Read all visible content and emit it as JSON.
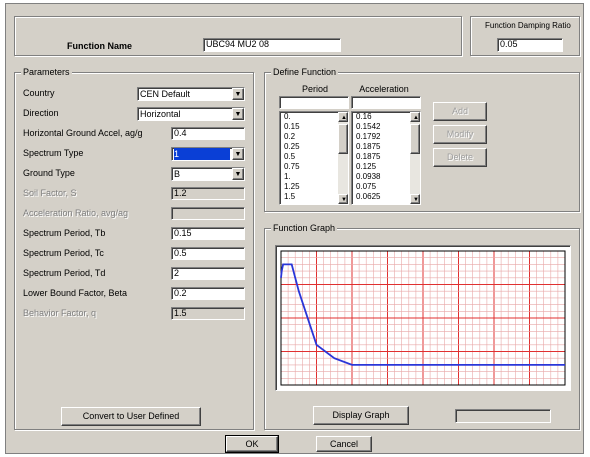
{
  "header": {
    "function_name_label": "Function Name",
    "function_name_value": "UBC94 MU2 08",
    "damping_label": "Function Damping Ratio",
    "damping_value": "0.05"
  },
  "parameters": {
    "group_label": "Parameters",
    "rows": [
      {
        "label": "Country",
        "value": "CEN Default",
        "kind": "combo",
        "enabled": true
      },
      {
        "label": "Direction",
        "value": "Horizontal",
        "kind": "combo",
        "enabled": true
      },
      {
        "label": "Horizontal Ground Accel, ag/g",
        "value": "0.4",
        "kind": "field",
        "enabled": true
      },
      {
        "label": "Spectrum Type",
        "value": "1",
        "kind": "combo",
        "enabled": true,
        "selected": true
      },
      {
        "label": "Ground Type",
        "value": "B",
        "kind": "combo",
        "enabled": true
      },
      {
        "label": "Soil Factor, S",
        "value": "1.2",
        "kind": "field",
        "enabled": false
      },
      {
        "label": "Acceleration Ratio, avg/ag",
        "value": "",
        "kind": "field",
        "enabled": false
      },
      {
        "label": "Spectrum Period, Tb",
        "value": "0.15",
        "kind": "field",
        "enabled": true
      },
      {
        "label": "Spectrum Period, Tc",
        "value": "0.5",
        "kind": "field",
        "enabled": true
      },
      {
        "label": "Spectrum Period, Td",
        "value": "2",
        "kind": "field",
        "enabled": true
      },
      {
        "label": "Lower Bound Factor, Beta",
        "value": "0.2",
        "kind": "field",
        "enabled": true
      },
      {
        "label": "Behavior Factor, q",
        "value": "1.5",
        "kind": "field",
        "enabled": false
      }
    ],
    "convert_button": "Convert to User Defined"
  },
  "define_function": {
    "group_label": "Define Function",
    "period_header": "Period",
    "accel_header": "Acceleration",
    "periods": [
      "0.",
      "0.15",
      "0.2",
      "0.25",
      "0.5",
      "0.75",
      "1.",
      "1.25",
      "1.5"
    ],
    "accelerations": [
      "0.16",
      "0.1542",
      "0.1792",
      "0.1875",
      "0.1875",
      "0.125",
      "0.0938",
      "0.075",
      "0.0625"
    ],
    "add_button": "Add",
    "modify_button": "Modify",
    "delete_button": "Delete"
  },
  "graph": {
    "group_label": "Function Graph",
    "display_button": "Display Graph",
    "colors": {
      "major": "#e03030",
      "minor": "#e8a8a8",
      "curve": "#2a36d8",
      "plot_bg": "#ffffff"
    }
  },
  "chart_data": {
    "type": "line",
    "x": [
      0,
      0.01,
      0.03,
      0.1,
      0.15,
      0.25,
      0.5,
      0.75,
      1.0,
      1.5,
      2.0,
      3.0,
      4.0
    ],
    "y": [
      0.16,
      0.17,
      0.18,
      0.18,
      0.18,
      0.14,
      0.06,
      0.04,
      0.03,
      0.03,
      0.03,
      0.03,
      0.03
    ],
    "xlim": [
      0,
      4
    ],
    "ylim": [
      0,
      0.2
    ],
    "grid": true
  },
  "footer": {
    "ok_button": "OK",
    "cancel_button": "Cancel"
  }
}
